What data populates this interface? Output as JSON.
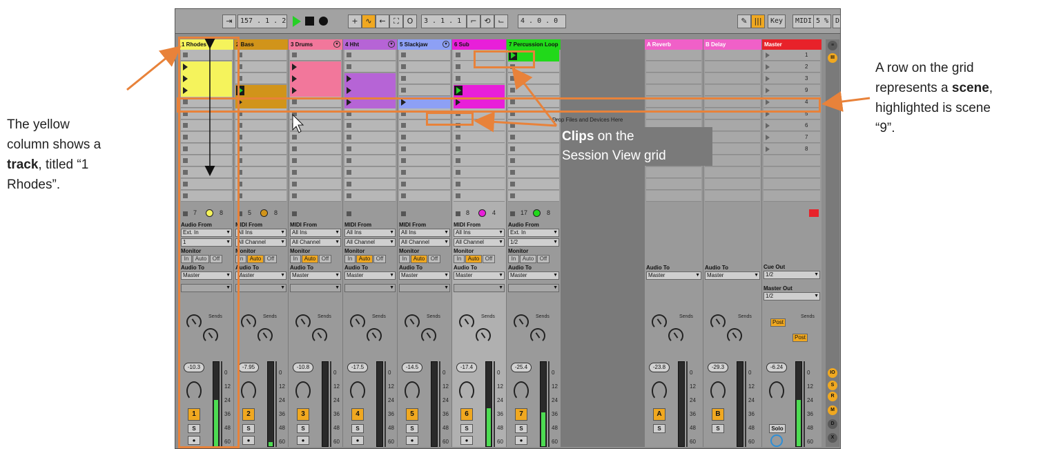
{
  "toolbar": {
    "tempo": "157 .  1 .  2",
    "position": "3 .  1 .  1",
    "loop_length": "4 .  0 .  0",
    "key_label": "Key",
    "midi_label": "MIDI",
    "cpu": "5 %",
    "d_label": "D"
  },
  "tracks": [
    {
      "name": "1 Rhodes",
      "color": "#f5f35c",
      "num_a": "7",
      "num_b": "8",
      "io_title": "Audio From",
      "from": "Ext. In",
      "channel": "1",
      "volume": "-10.3",
      "button": "1",
      "meter": 0.55
    },
    {
      "name": "2 Bass",
      "color": "#d1941a",
      "num_a": "5",
      "num_b": "8",
      "io_title": "MIDI From",
      "from": "All Ins",
      "channel": "All Channel",
      "volume": "-7.95",
      "button": "2",
      "meter": 0.05
    },
    {
      "name": "3 Drums",
      "color": "#f2779b",
      "num_a": "",
      "num_b": "",
      "io_title": "MIDI From",
      "from": "All Ins",
      "channel": "All Channel",
      "volume": "-10.8",
      "button": "3",
      "meter": 0.0
    },
    {
      "name": "4 Hht",
      "color": "#b664d6",
      "num_a": "",
      "num_b": "",
      "io_title": "MIDI From",
      "from": "All Ins",
      "channel": "All Channel",
      "volume": "-17.5",
      "button": "4",
      "meter": 0.0
    },
    {
      "name": "5 Slackjaw",
      "color": "#8da0f5",
      "num_a": "",
      "num_b": "",
      "io_title": "MIDI From",
      "from": "All Ins",
      "channel": "All Channel",
      "volume": "-14.5",
      "button": "5",
      "meter": 0.0
    },
    {
      "name": "6 Sub",
      "color": "#e81fd9",
      "num_a": "8",
      "num_b": "4",
      "io_title": "MIDI From",
      "from": "All Ins",
      "channel": "All Channel",
      "volume": "-17.4",
      "button": "6",
      "meter": 0.45
    },
    {
      "name": "7 Percussion Loop",
      "color": "#21d91a",
      "num_a": "17",
      "num_b": "8",
      "io_title": "Audio From",
      "from": "Ext. In",
      "channel": "1/2",
      "volume": "-25.4",
      "button": "7",
      "meter": 0.4
    }
  ],
  "returns": [
    {
      "name": "A Reverb",
      "color": "#f060c8",
      "volume": "-23.8",
      "button": "A"
    },
    {
      "name": "B Delay",
      "color": "#f060c8",
      "volume": "-29.3",
      "button": "B"
    }
  ],
  "master": {
    "name": "Master",
    "color": "#e8222a",
    "volume": "-6.24",
    "cue_out_label": "Cue Out",
    "cue_out": "1/2",
    "master_out_label": "Master Out",
    "master_out": "1/2",
    "post": "Post",
    "solo": "Solo"
  },
  "scenes": [
    "1",
    "2",
    "3",
    "9",
    "4",
    "5",
    "6",
    "7",
    "8"
  ],
  "labels": {
    "monitor": "Monitor",
    "in": "In",
    "auto": "Auto",
    "off": "Off",
    "audio_to": "Audio To",
    "master_dest": "Master",
    "sends": "Sends",
    "s": "S",
    "drop": "Drop Files and Devices Here",
    "scale": [
      "0",
      "12",
      "24",
      "36",
      "48",
      "60"
    ]
  },
  "annotations": {
    "track": "The yellow column shows a track, titled “1 Rhodes”.",
    "track_parts": [
      "The yellow",
      "column shows a",
      "track",
      ", titled “1",
      "Rhodes”."
    ],
    "clips_bold": "Clips",
    "clips_rest1": " on the",
    "clips_rest2": "Session View grid",
    "scene_l1": "A row on the grid",
    "scene_l2a": "represents a ",
    "scene_l2b": "scene",
    "scene_l2c": ",",
    "scene_l3": "highlighted is scene",
    "scene_l4": "“9”."
  },
  "colors": {
    "annotation": "#e8823a",
    "meter": "#4ddc52",
    "orange": "#f0a820"
  }
}
